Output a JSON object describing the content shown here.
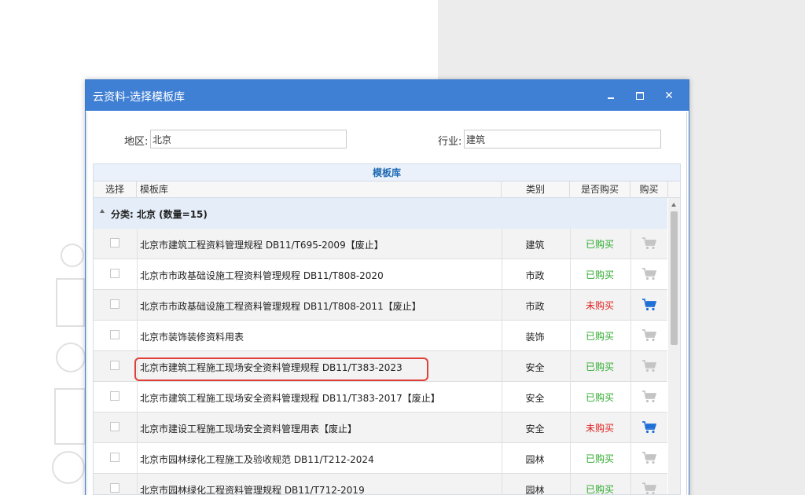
{
  "window": {
    "title": "云资料-选择模板库",
    "close_glyph": "✕"
  },
  "filters": {
    "region_label": "地区:",
    "region_value": "北京",
    "industry_label": "行业:",
    "industry_value": "建筑"
  },
  "grid": {
    "caption": "模板库",
    "columns": [
      "选择",
      "模板库",
      "类别",
      "是否购买",
      "购买"
    ],
    "group_label": "分类: 北京 (数量=15)",
    "rows": [
      {
        "name": "北京市建筑工程资料管理规程 DB11/T695-2009【废止】",
        "category": "建筑",
        "status": "已购买",
        "purchased": true
      },
      {
        "name": "北京市市政基础设施工程资料管理规程 DB11/T808-2020",
        "category": "市政",
        "status": "已购买",
        "purchased": true
      },
      {
        "name": "北京市市政基础设施工程资料管理规程 DB11/T808-2011【废止】",
        "category": "市政",
        "status": "未购买",
        "purchased": false
      },
      {
        "name": "北京市装饰装修资料用表",
        "category": "装饰",
        "status": "已购买",
        "purchased": true
      },
      {
        "name": "北京市建筑工程施工现场安全资料管理规程 DB11/T383-2023",
        "category": "安全",
        "status": "已购买",
        "purchased": true
      },
      {
        "name": "北京市建筑工程施工现场安全资料管理规程 DB11/T383-2017【废止】",
        "category": "安全",
        "status": "已购买",
        "purchased": true
      },
      {
        "name": "北京市建设工程施工现场安全资料管理用表【废止】",
        "category": "安全",
        "status": "未购买",
        "purchased": false
      },
      {
        "name": "北京市园林绿化工程施工及验收规范 DB11/T212-2024",
        "category": "园林",
        "status": "已购买",
        "purchased": true
      },
      {
        "name": "北京市园林绿化工程资料管理规程 DB11/T712-2019",
        "category": "园林",
        "status": "已购买",
        "purchased": true
      }
    ]
  },
  "colors": {
    "titlebar": "#3f7fd4",
    "purchased": "#2eaa2e",
    "not_purchased": "#e02020",
    "cart_active": "#1f6fd6",
    "cart_inactive": "#c4c4c4",
    "highlight": "#e0403a"
  },
  "icons": {
    "cart": "shopping-cart-icon",
    "minimize": "minimize-icon",
    "maximize": "maximize-icon",
    "close": "close-icon",
    "collapse": "caret-up-icon"
  }
}
